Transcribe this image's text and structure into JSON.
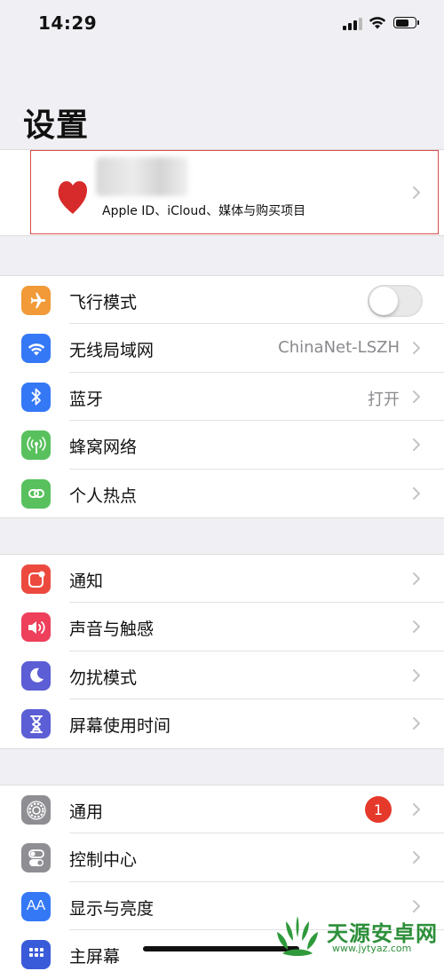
{
  "status_bar": {
    "time": "14:29"
  },
  "title": "设置",
  "account": {
    "subtitle": "Apple ID、iCloud、媒体与购买项目"
  },
  "groups": [
    {
      "rows": [
        {
          "label": "飞行模式",
          "icon": "airplane-icon",
          "color": "#f19a37",
          "toggle": false
        },
        {
          "label": "无线局域网",
          "icon": "wifi-icon",
          "color": "#3478f6",
          "value": "ChinaNet-LSZH"
        },
        {
          "label": "蓝牙",
          "icon": "bluetooth-icon",
          "color": "#3478f6",
          "value": "打开"
        },
        {
          "label": "蜂窝网络",
          "icon": "cellular-icon",
          "color": "#58c15d"
        },
        {
          "label": "个人热点",
          "icon": "hotspot-icon",
          "color": "#58c15d"
        }
      ]
    },
    {
      "rows": [
        {
          "label": "通知",
          "icon": "notifications-icon",
          "color": "#ec4a3f"
        },
        {
          "label": "声音与触感",
          "icon": "sound-icon",
          "color": "#ee3f5b"
        },
        {
          "label": "勿扰模式",
          "icon": "moon-icon",
          "color": "#5b5ed4"
        },
        {
          "label": "屏幕使用时间",
          "icon": "hourglass-icon",
          "color": "#5b5ed4"
        }
      ]
    },
    {
      "rows": [
        {
          "label": "通用",
          "icon": "gear-icon",
          "color": "#8e8e93",
          "badge": "1"
        },
        {
          "label": "控制中心",
          "icon": "switches-icon",
          "color": "#8e8e93"
        },
        {
          "label": "显示与亮度",
          "icon": "text-size-icon",
          "color": "#3478f6",
          "icon_text": "AA"
        },
        {
          "label": "主屏幕",
          "icon": "home-screen-icon",
          "color": "#3a5bd9"
        }
      ]
    }
  ],
  "watermark": {
    "title": "天源安卓网",
    "url": "www.jytyaz.com"
  }
}
